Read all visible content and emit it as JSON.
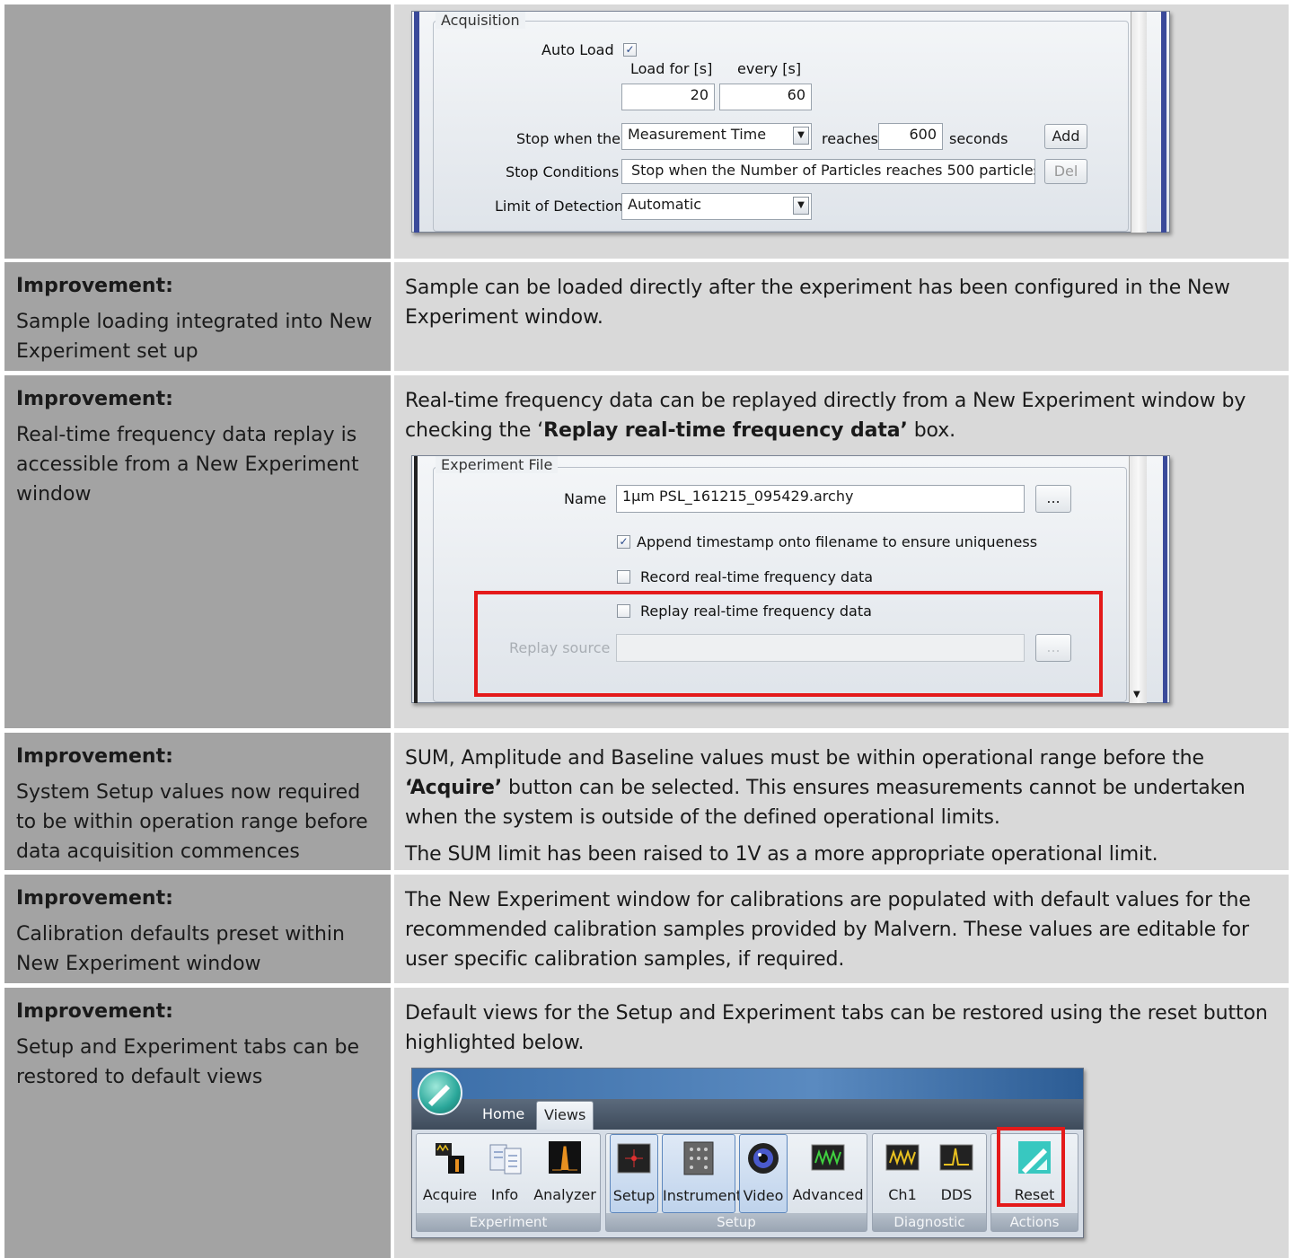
{
  "rows": [
    {
      "heading": "",
      "description": "",
      "paragraphs": []
    },
    {
      "heading": "Improvement:",
      "description": "Sample loading integrated into New Experiment set up",
      "paragraphs": [
        "Sample can be loaded directly after the experiment has been configured in the New Experiment window."
      ]
    },
    {
      "heading": "Improvement:",
      "description": "Real-time frequency data replay is accessible from a New Experiment window",
      "para_pre": "Real-time frequency data can be replayed directly from a New Experiment window by checking the ‘",
      "para_bold": "Replay real-time frequency data’",
      "para_post": " box."
    },
    {
      "heading": "Improvement:",
      "description": "System Setup values now required to be within operation range before data acquisition commences",
      "para_pre": "SUM, Amplitude and Baseline values must be within operational range before the ",
      "para_bold": "‘Acquire’",
      "para_post": " button can be selected. This ensures measurements cannot be undertaken when the system is outside of the defined operational limits.",
      "para2": "The SUM limit has been raised to 1V as a more appropriate operational limit."
    },
    {
      "heading": "Improvement:",
      "description": "Calibration defaults preset within New Experiment window",
      "paragraphs": [
        "The New Experiment window for calibrations are populated with default values for the recommended calibration samples provided by Malvern. These values are editable for user specific calibration samples, if required."
      ]
    },
    {
      "heading": "Improvement:",
      "description": "Setup and Experiment tabs can be restored to default views",
      "paragraphs": [
        "Default views for the Setup and Experiment tabs can be restored using the reset button highlighted below."
      ]
    }
  ],
  "acquisition": {
    "group_title": "Acquisition",
    "auto_load_label": "Auto Load",
    "auto_load_checked": true,
    "load_for_label": "Load for [s]",
    "every_label": "every [s]",
    "load_for_value": "20",
    "every_value": "60",
    "stop_when_label": "Stop when the",
    "stop_when_value": "Measurement Time",
    "reaches_label": "reaches",
    "reaches_value": "600",
    "seconds_label": "seconds",
    "add_label": "Add",
    "stop_conditions_label": "Stop Conditions",
    "stop_conditions_value": "Stop when the Number of Particles reaches 500 particles",
    "del_label": "Del",
    "lod_label": "Limit of Detection",
    "lod_value": "Automatic"
  },
  "experiment_file": {
    "group_title": "Experiment File",
    "name_label": "Name",
    "name_value": "1µm PSL_161215_095429.archy",
    "browse_label": "...",
    "append_label": "Append timestamp onto filename to ensure uniqueness",
    "append_checked": true,
    "record_label": "Record real-time frequency data",
    "record_checked": false,
    "replay_label": "Replay real-time frequency data",
    "replay_checked": false,
    "replay_source_label": "Replay source",
    "replay_browse_label": "..."
  },
  "ribbon": {
    "tabs": [
      "Home",
      "Views"
    ],
    "selected_tab": "Views",
    "groups": [
      {
        "label": "Experiment",
        "buttons": [
          "Acquire",
          "Info",
          "Analyzer"
        ]
      },
      {
        "label": "Setup",
        "buttons": [
          "Setup",
          "Instrument",
          "Video",
          "Advanced"
        ]
      },
      {
        "label": "Diagnostic",
        "buttons": [
          "Ch1",
          "DDS"
        ]
      },
      {
        "label": "Actions",
        "buttons": [
          "Reset"
        ]
      }
    ]
  },
  "colors": {
    "left_bg": "#a3a3a3",
    "right_bg": "#d9d9d9",
    "highlight": "#e41a1a"
  }
}
